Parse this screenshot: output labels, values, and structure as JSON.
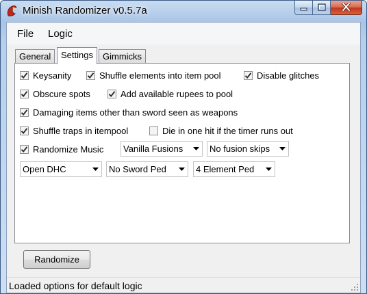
{
  "window": {
    "title": "Minish Randomizer v0.5.7a",
    "icon": "minish-cap-icon",
    "caption_buttons": [
      "minimize-icon",
      "maximize-icon",
      "close-icon"
    ]
  },
  "menu": {
    "items": [
      "File",
      "Logic"
    ]
  },
  "tabs": {
    "items": [
      "General",
      "Settings",
      "Gimmicks"
    ],
    "active": "Settings"
  },
  "settings": {
    "keysanity": {
      "label": "Keysanity",
      "checked": true
    },
    "shuffle_elements": {
      "label": "Shuffle elements into item pool",
      "checked": true
    },
    "disable_glitches": {
      "label": "Disable glitches",
      "checked": true
    },
    "obscure_spots": {
      "label": "Obscure spots",
      "checked": true
    },
    "add_rupees": {
      "label": "Add available rupees to pool",
      "checked": true
    },
    "damaging_items": {
      "label": "Damaging items other than sword seen as weapons",
      "checked": true
    },
    "shuffle_traps": {
      "label": "Shuffle traps in itempool",
      "checked": true
    },
    "die_one_hit": {
      "label": "Die in one hit if the timer runs out",
      "checked": false
    },
    "randomize_music": {
      "label": "Randomize Music",
      "checked": true
    },
    "fusions_select": {
      "value": "Vanilla Fusions"
    },
    "fusion_skips_select": {
      "value": "No fusion skips"
    },
    "dhc_select": {
      "value": "Open DHC"
    },
    "sword_ped_select": {
      "value": "No Sword Ped"
    },
    "element_ped_select": {
      "value": "4 Element Ped"
    }
  },
  "actions": {
    "randomize_label": "Randomize"
  },
  "status": {
    "text": "Loaded options for default logic"
  },
  "colors": {
    "title_gradient_top": "#c9dcf1",
    "close_button": "#c2381a",
    "panel_bg": "#ffffff",
    "client_bg": "#f0f0f0"
  }
}
